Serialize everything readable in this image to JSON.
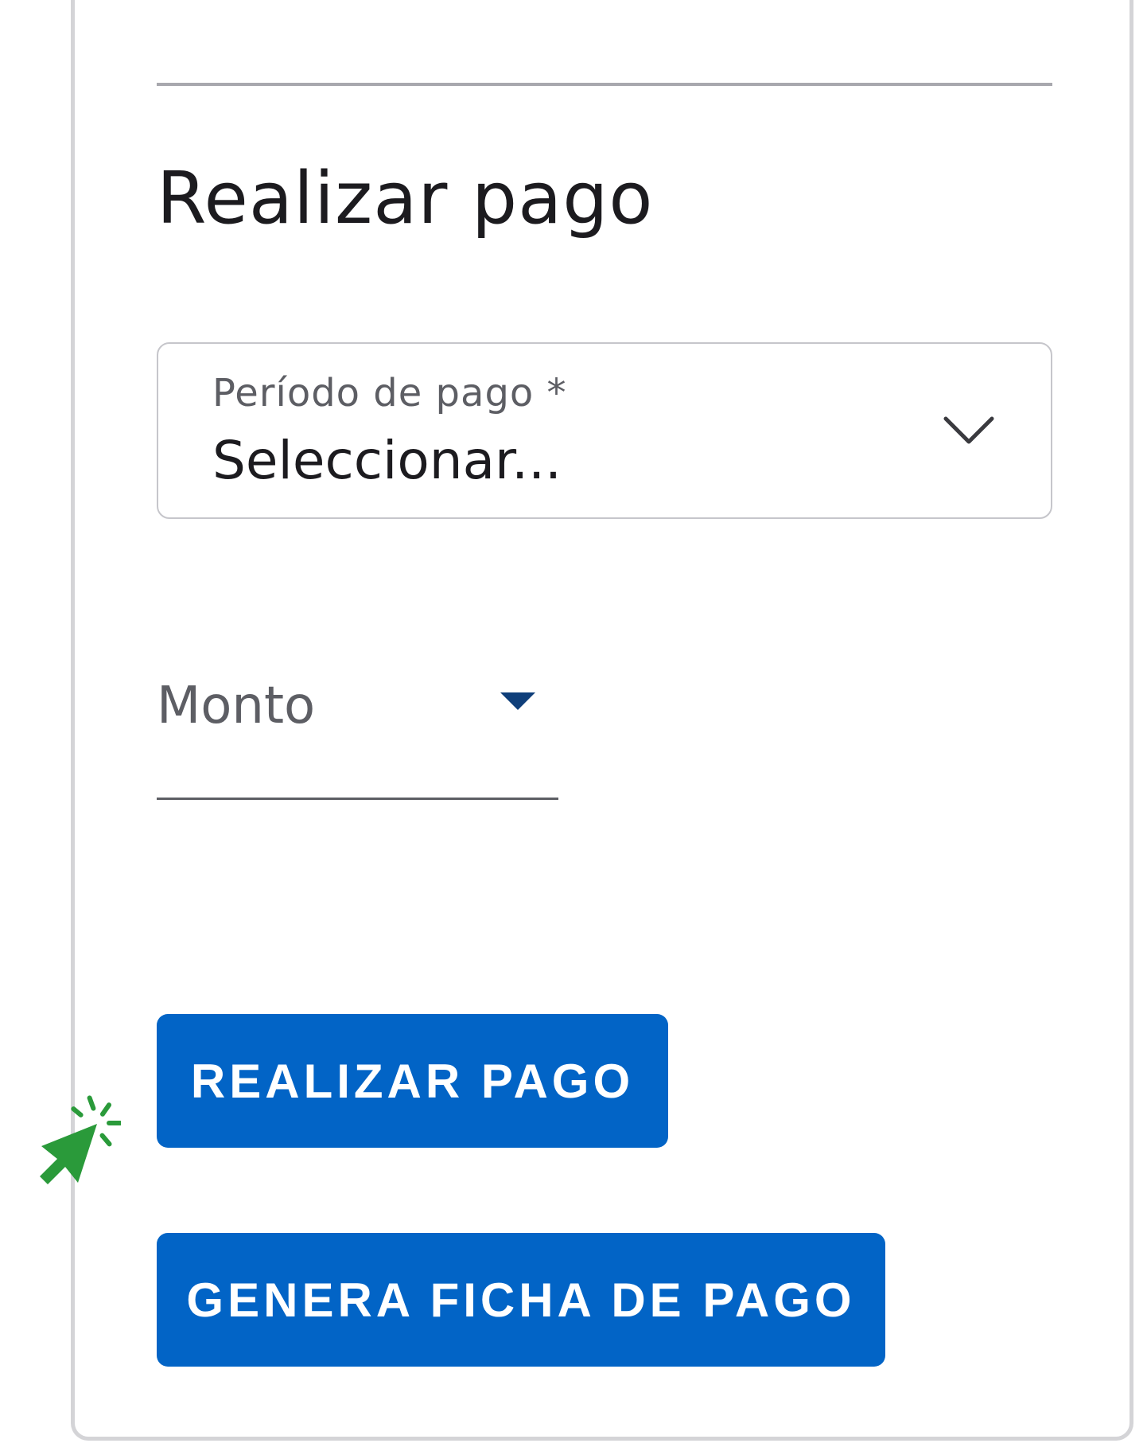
{
  "section": {
    "title": "Realizar pago"
  },
  "period_select": {
    "label": "Período de pago *",
    "value": "Seleccionar..."
  },
  "amount_select": {
    "label": "Monto"
  },
  "buttons": {
    "pay_label": "REALIZAR PAGO",
    "ficha_label": "GENERA FICHA DE PAGO"
  },
  "icons": {
    "chevron": "chevron-down-icon",
    "caret": "caret-down-icon",
    "pointer": "click-pointer-icon"
  },
  "colors": {
    "primary_button": "#0264c6",
    "caret": "#0f3f7a",
    "pointer": "#2a9a3a",
    "text": "#1c1b1f",
    "muted_text": "#5d5e64"
  }
}
